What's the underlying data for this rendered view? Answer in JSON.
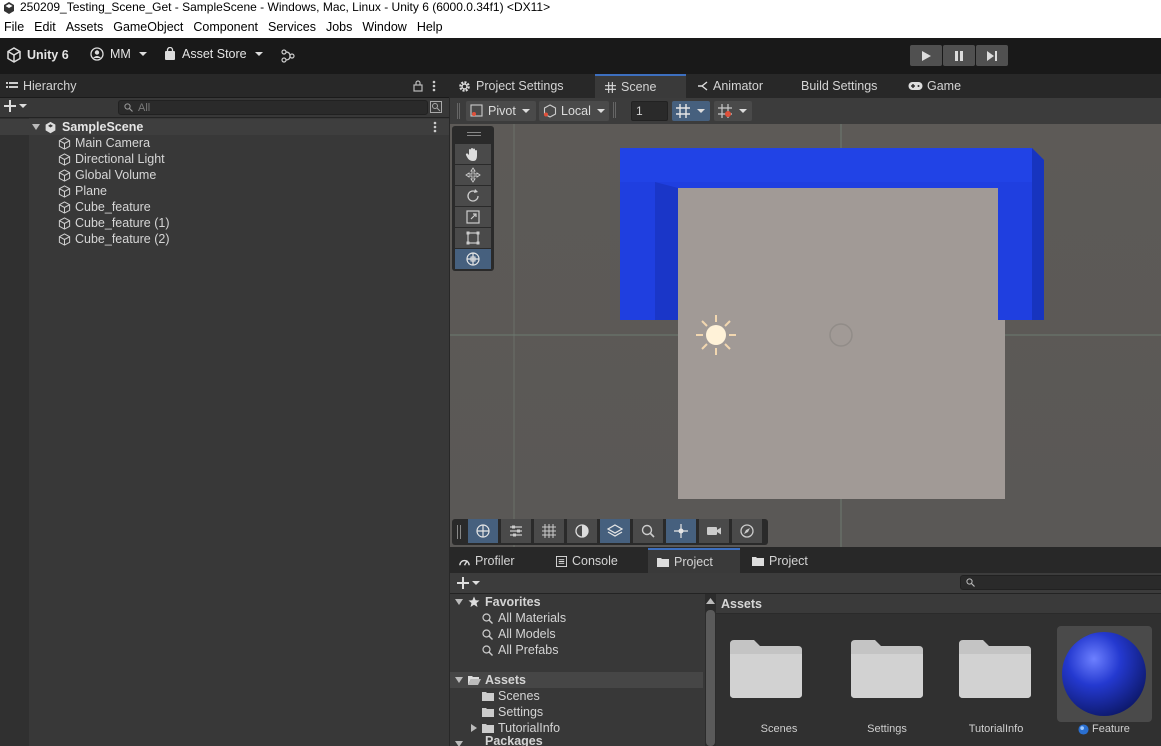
{
  "window": {
    "title": "250209_Testing_Scene_Get - SampleScene - Windows, Mac, Linux - Unity 6 (6000.0.34f1) <DX11>"
  },
  "menu": [
    "File",
    "Edit",
    "Assets",
    "GameObject",
    "Component",
    "Services",
    "Jobs",
    "Window",
    "Help"
  ],
  "toolbar": {
    "unity_label": "Unity 6",
    "account_label": "MM",
    "asset_store_label": "Asset Store"
  },
  "hierarchy": {
    "tab_label": "Hierarchy",
    "search_placeholder": "All",
    "scene_name": "SampleScene",
    "items": [
      "Main Camera",
      "Directional Light",
      "Global Volume",
      "Plane",
      "Cube_feature",
      "Cube_feature (1)",
      "Cube_feature (2)"
    ]
  },
  "scene_tabs": {
    "project_settings": "Project Settings",
    "scene": "Scene",
    "animator": "Animator",
    "build_settings": "Build Settings",
    "game": "Game"
  },
  "scene_toolbar": {
    "pivot": "Pivot",
    "local": "Local",
    "grid_size": "1"
  },
  "bottom_tabs": {
    "profiler": "Profiler",
    "console": "Console",
    "project_active": "Project",
    "project_second": "Project"
  },
  "project": {
    "favorites_label": "Favorites",
    "favorites": [
      "All Materials",
      "All Models",
      "All Prefabs"
    ],
    "assets_label": "Assets",
    "asset_folders": [
      "Scenes",
      "Settings",
      "TutorialInfo"
    ],
    "packages_label": "Packages",
    "breadcrumb": "Assets",
    "grid_items": [
      "Scenes",
      "Settings",
      "TutorialInfo",
      "Feature"
    ]
  },
  "colors": {
    "accent": "#3d6fbf",
    "cube_blue": "#1f3fe0",
    "plane": "#a19a96"
  }
}
